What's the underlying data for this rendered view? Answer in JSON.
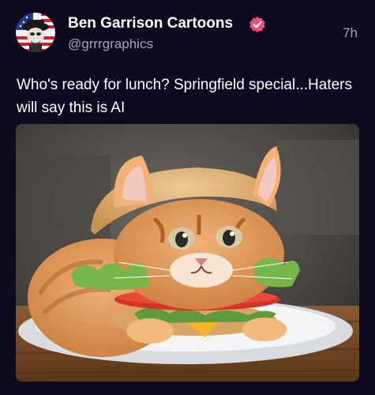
{
  "post": {
    "author_name": "Ben Garrison Cartoons",
    "author_handle": "@grrrgraphics",
    "timestamp": "7h",
    "text": "Who's ready for lunch? Springfield special...Haters will say this is AI",
    "verified": true
  },
  "colors": {
    "background": "#0e0a20",
    "verified_badge": "#e8507a",
    "secondary_text": "#a6a3b8"
  },
  "icons": {
    "verified": "verified-badge-icon",
    "avatar": "avatar-image"
  },
  "media": {
    "description_visible": false
  }
}
